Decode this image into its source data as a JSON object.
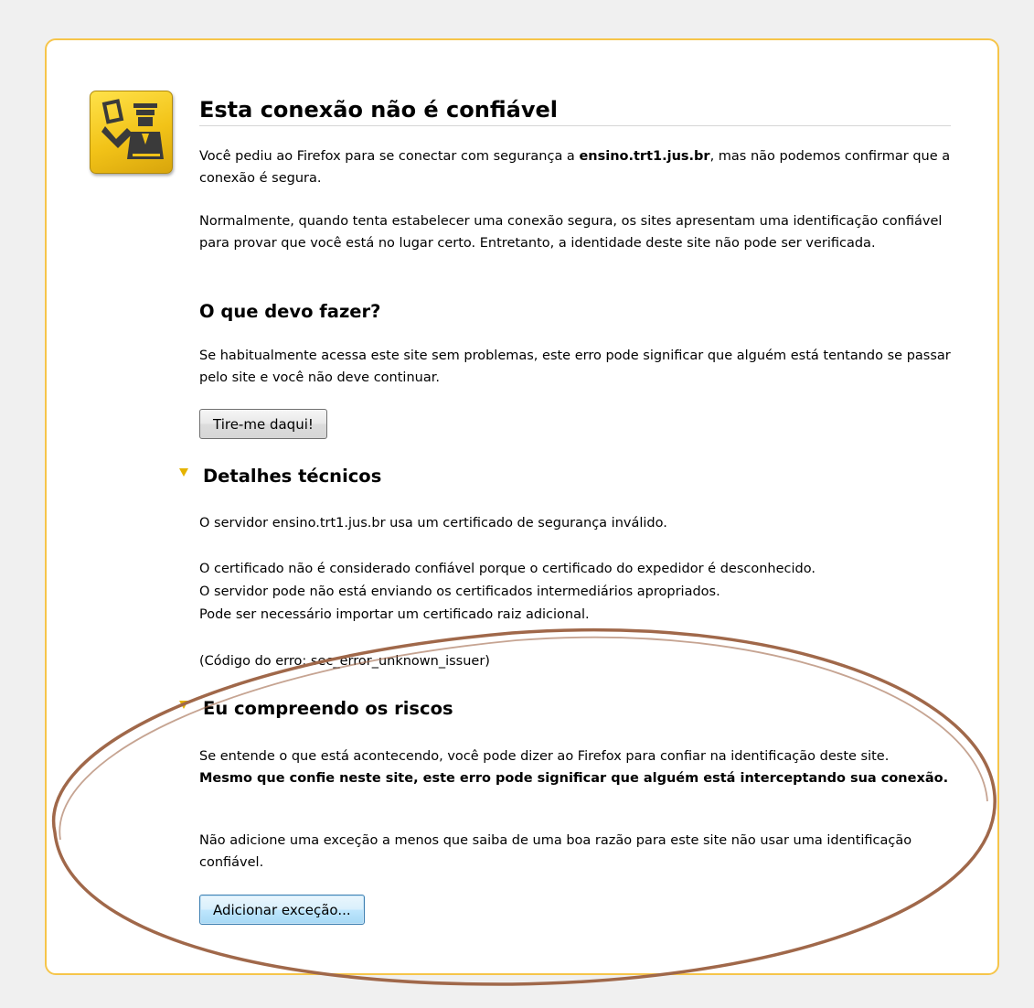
{
  "error": {
    "title": "Esta conexão não é confiável",
    "intro_before": "Você pediu ao Firefox para se conectar  com segurança a ",
    "intro_host": "ensino.trt1.jus.br",
    "intro_after": ", mas não podemos confirmar que a conexão é segura.",
    "normal": "Normalmente, quando tenta estabelecer uma conexão segura, os sites apresentam uma identificação confiável para provar que você está  no lugar certo. Entretanto, a identidade deste site não pode ser verificada."
  },
  "what_to_do": {
    "heading": "O que devo fazer?",
    "text": "Se habitualmente acessa  este site sem problemas, este erro pode significar que alguém está  tentando se passar pelo site e você não deve continuar.",
    "get_me_out_label": "Tire-me daqui!"
  },
  "technical": {
    "heading": "Detalhes técnicos",
    "line1": "O servidor ensino.trt1.jus.br usa um certificado de segurança inválido.",
    "line2": "O certificado não é considerado confiável porque o certificado do expedidor é desconhecido.",
    "line3": "O servidor pode não está enviando os certificados intermediários apropriados.",
    "line4": "Pode ser necessário importar um certificado raiz adicional.",
    "error_code": "(Código do erro: sec_error_unknown_issuer)"
  },
  "risks": {
    "heading": "Eu compreendo os riscos",
    "text_plain": "Se entende o que está acontecendo, você  pode dizer ao Firefox para confiar na identificação deste site.",
    "text_bold": "Mesmo que confie neste site, este erro pode significar que alguém está  interceptando sua conexão.",
    "warning": "Não adicione uma exceção a menos  que saiba de uma boa razão para este site não usar uma identificação confiável.",
    "add_exception_label": "Adicionar exceção..."
  },
  "colors": {
    "page_bg": "#f0f0f0",
    "card_border": "#f6c54a",
    "twisty": "#e5b300",
    "annotation_ellipse": "#a0684a"
  }
}
